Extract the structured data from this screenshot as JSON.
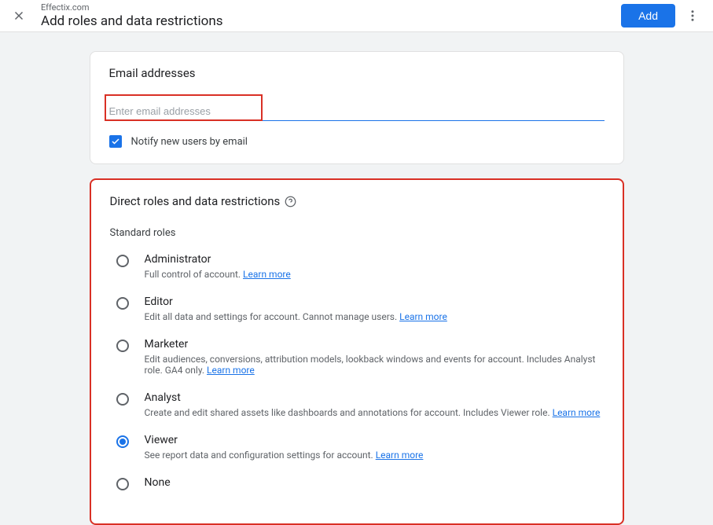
{
  "header": {
    "subtitle": "Effectix.com",
    "title": "Add roles and data restrictions",
    "addButton": "Add"
  },
  "emailCard": {
    "title": "Email addresses",
    "placeholder": "Enter email addresses",
    "notifyLabel": "Notify new users by email"
  },
  "rolesCard": {
    "title": "Direct roles and data restrictions",
    "subtitle": "Standard roles",
    "learnMore": "Learn more",
    "roles": [
      {
        "name": "Administrator",
        "desc": "Full control of account. ",
        "selected": false
      },
      {
        "name": "Editor",
        "desc": "Edit all data and settings for account. Cannot manage users. ",
        "selected": false
      },
      {
        "name": "Marketer",
        "desc": "Edit audiences, conversions, attribution models, lookback windows and events for account. Includes Analyst role. GA4 only. ",
        "selected": false
      },
      {
        "name": "Analyst",
        "desc": "Create and edit shared assets like dashboards and annotations for account. Includes Viewer role. ",
        "selected": false
      },
      {
        "name": "Viewer",
        "desc": "See report data and configuration settings for account. ",
        "selected": true
      },
      {
        "name": "None",
        "desc": "",
        "selected": false
      }
    ]
  }
}
